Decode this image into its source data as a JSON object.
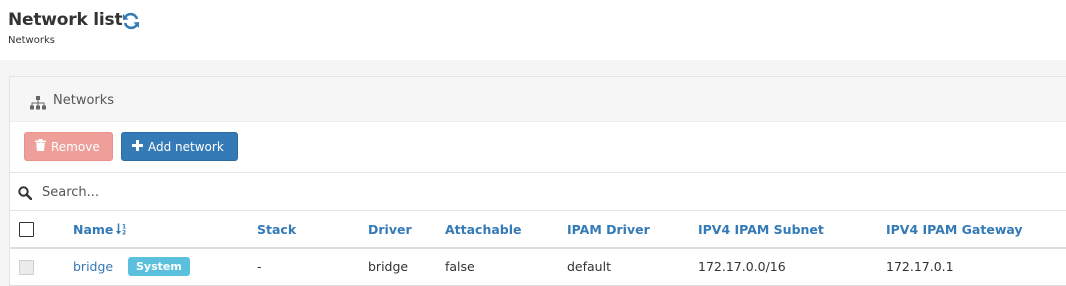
{
  "header": {
    "title": "Network list",
    "subtitle": "Networks"
  },
  "panel": {
    "title": "Networks",
    "remove_label": "Remove",
    "add_label": "Add network"
  },
  "search": {
    "placeholder": "Search..."
  },
  "table": {
    "columns": [
      "Name",
      "Stack",
      "Driver",
      "Attachable",
      "IPAM Driver",
      "IPV4 IPAM Subnet",
      "IPV4 IPAM Gateway"
    ],
    "rows": [
      {
        "name": "bridge",
        "badge": "System",
        "stack": "-",
        "driver": "bridge",
        "attachable": "false",
        "ipam_driver": "default",
        "subnet": "172.17.0.0/16",
        "gateway": "172.17.0.1"
      }
    ]
  },
  "colors": {
    "primary": "#337ab7",
    "danger_disabled": "#ee9f9a",
    "info_badge": "#5bc0de"
  },
  "icons": [
    "refresh-icon",
    "sitemap-icon",
    "trash-icon",
    "plus-icon",
    "search-icon",
    "sort-alpha-icon"
  ]
}
